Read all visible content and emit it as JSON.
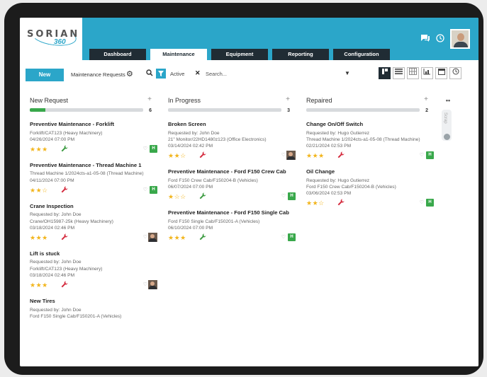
{
  "header": {
    "logo_text": "SORIAN",
    "logo_sub": "360",
    "tabs": [
      {
        "label": "Dashboard",
        "active": false
      },
      {
        "label": "Maintenance",
        "active": true
      },
      {
        "label": "Equipment",
        "active": false
      },
      {
        "label": "Reporting",
        "active": false
      },
      {
        "label": "Configuration",
        "active": false
      }
    ],
    "icons": [
      "chat-icon",
      "clock-icon",
      "user-avatar"
    ]
  },
  "toolbar": {
    "new_label": "New",
    "requests_label": "Maintenance Requests",
    "filter_chip": "Active",
    "search_placeholder": "Search...",
    "view_icons": [
      "kanban-icon",
      "list-icon",
      "grid-icon",
      "chart-icon",
      "calendar-icon",
      "clock-icon"
    ]
  },
  "columns": [
    {
      "title": "New Request",
      "count": "6",
      "progress": 0.14,
      "cards": [
        {
          "title": "Preventive Maintenance - Forklift",
          "lines": [
            "Forklift/CAT123 (Heavy Machinery)",
            "04/26/2024 07:00 PM"
          ],
          "stars": "★★★",
          "wrench_color": "#3a9a3f",
          "right": "badge"
        },
        {
          "title": "Preventive Maintenance - Thread Machine 1",
          "lines": [
            "Thread Machine 1/2024cts-a1-05-08 (Thread Machine)",
            "04/11/2024 07:00 PM"
          ],
          "stars": "★★☆",
          "wrench_color": "#d42a3d",
          "right": "badge"
        },
        {
          "title": "Crane Inspection",
          "lines": [
            "Requested by: John Doe",
            "Crane/OH15987-25k (Heavy Machinery)",
            "03/18/2024 02:46 PM"
          ],
          "stars": "★★★",
          "wrench_color": "#d42a3d",
          "right": "avatar"
        },
        {
          "title": "Lift is stuck",
          "lines": [
            "Requested by: John Doe",
            "Forklift/CAT123 (Heavy Machinery)",
            "03/18/2024 02:46 PM"
          ],
          "stars": "★★★",
          "wrench_color": "#d42a3d",
          "right": "avatar"
        },
        {
          "title": "New Tires",
          "lines": [
            "Requested by: John Doe",
            "Ford F150 Single Cab/F150201-A (Vehicles)"
          ],
          "stars": "",
          "wrench_color": "",
          "right": ""
        }
      ]
    },
    {
      "title": "In Progress",
      "count": "3",
      "progress": 0,
      "cards": [
        {
          "title": "Broken Screen",
          "lines": [
            "Requested by: John Doe",
            "21\" Monitor/22HD1480z123 (Office Electronics)",
            "03/14/2024 02:42 PM"
          ],
          "stars": "★★☆",
          "wrench_color": "#d42a3d",
          "right": "avatar"
        },
        {
          "title": "Preventive Maintenance - Ford F150 Crew Cab",
          "lines": [
            "Ford F150 Crew Cab/F150204-B (Vehicles)",
            "06/07/2024 07:00 PM"
          ],
          "stars": "★☆☆",
          "wrench_color": "#3a9a3f",
          "right": "badge"
        },
        {
          "title": "Preventive Maintenance - Ford F150 Single Cab",
          "lines": [
            "Ford F150 Single Cab/F150201-A (Vehicles)",
            "06/10/2024 07:00 PM"
          ],
          "stars": "★★★",
          "wrench_color": "#3a9a3f",
          "right": "badge"
        }
      ]
    },
    {
      "title": "Repaired",
      "count": "2",
      "progress": 0,
      "cards": [
        {
          "title": "Change On/Off Switch",
          "lines": [
            "Requested by: Hugo Gutierrez",
            "Thread Machine 1/2024cts-a1-05-08 (Thread Machine)",
            "02/21/2024 02:53 PM"
          ],
          "stars": "★★★",
          "wrench_color": "#d42a3d",
          "right": "badge"
        },
        {
          "title": "Oil Change",
          "lines": [
            "Requested by: Hugo Gutierrez",
            "Ford F150 Crew Cab/F150204-B (Vehicles)",
            "03/06/2024 02:53 PM"
          ],
          "stars": "★★☆",
          "wrench_color": "#d42a3d",
          "right": "badge"
        }
      ]
    }
  ],
  "side_panel": {
    "dots": "••",
    "label": "Scrap"
  },
  "card_badge_text": "H",
  "card_heart": "♡",
  "colors": {
    "accent": "#2ba6c9",
    "dark": "#202c34",
    "green": "#39a84b",
    "star": "#f2b51c"
  }
}
